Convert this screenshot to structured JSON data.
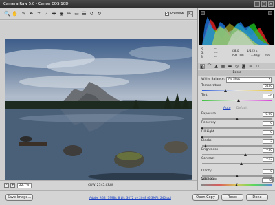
{
  "window": {
    "title": "Camera Raw 5.0  -  Canon EOS 10D",
    "minimize": "_",
    "maximize": "□",
    "close": "×"
  },
  "toolbar": {
    "tools": [
      "zoom-icon",
      "hand-icon",
      "white-balance-icon",
      "color-sampler-icon",
      "crop-icon",
      "straighten-icon",
      "retouch-icon",
      "red-eye-icon",
      "adjustment-brush-icon",
      "graduated-filter-icon",
      "preferences-icon",
      "rotate-left-icon",
      "rotate-right-icon"
    ],
    "preview_label": "Preview",
    "preview_checked": "✓",
    "fullscreen_icon": "⇱"
  },
  "statusbar": {
    "zoom_minus": "-",
    "zoom_plus": "+",
    "zoom_value": "22.7%",
    "filename": "CRW_2745.CRW"
  },
  "info": {
    "r_label": "R:",
    "r_value": "---",
    "g_label": "G:",
    "g_value": "---",
    "b_label": "B:",
    "b_value": "---",
    "aperture": "f/8.0",
    "shutter": "1/125 s",
    "iso": "ISO 100",
    "focal": "17-40@17 mm"
  },
  "panel": {
    "tabs": [
      "basic-icon",
      "tone-curve-icon",
      "detail-icon",
      "hsl-icon",
      "split-toning-icon",
      "lens-icon",
      "camera-calibration-icon",
      "presets-icon",
      "snapshots-icon"
    ],
    "title": "Basic",
    "white_balance_label": "White Balance:",
    "white_balance_value": "As Shot",
    "auto_link": "Auto",
    "default_link": "Default",
    "sliders": [
      {
        "label": "Temperature",
        "value": "5450",
        "fraction": 0.33
      },
      {
        "label": "Tint",
        "value": "+6",
        "fraction": 0.52
      },
      {
        "label": "Exposure",
        "value": "0.00",
        "fraction": 0.5
      },
      {
        "label": "Recovery",
        "value": "0",
        "fraction": 0.0
      },
      {
        "label": "Fill Light",
        "value": "0",
        "fraction": 0.0
      },
      {
        "label": "Blacks",
        "value": "5",
        "fraction": 0.05
      },
      {
        "label": "Brightness",
        "value": "+50",
        "fraction": 0.62
      },
      {
        "label": "Contrast",
        "value": "+25",
        "fraction": 0.56
      },
      {
        "label": "Clarity",
        "value": "0",
        "fraction": 0.5
      },
      {
        "label": "Vibrance",
        "value": "0",
        "fraction": 0.5
      },
      {
        "label": "Saturation",
        "value": "0",
        "fraction": 0.5
      }
    ]
  },
  "bottom": {
    "save_image": "Save Image...",
    "workflow_link": "Adobe RGB (1998); 8 bit; 3072 by 2048 (6.3MP); 240 ppi",
    "open_copy": "Open Copy",
    "reset": "Reset",
    "done": "Done"
  }
}
